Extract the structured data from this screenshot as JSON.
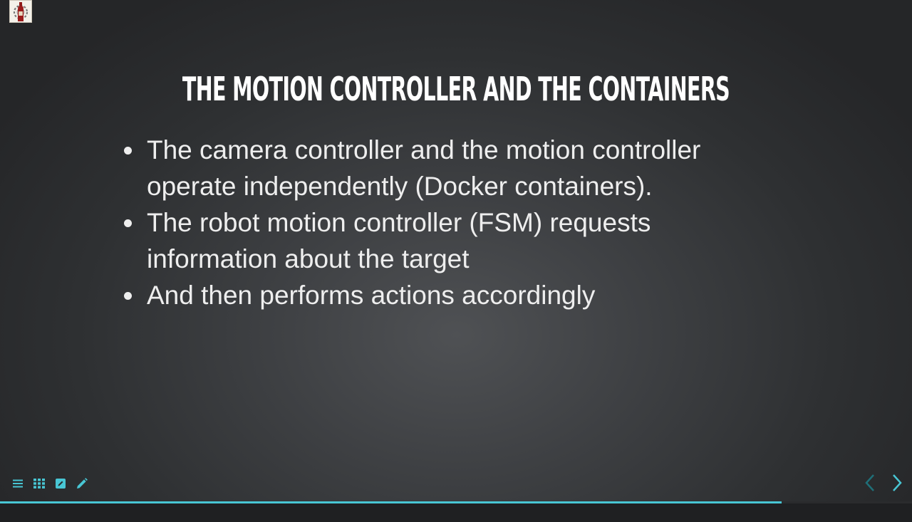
{
  "slide": {
    "title": "THE MOTION CONTROLLER AND THE CONTAINERS",
    "bullets": [
      {
        "line1": "The camera controller and the motion controller",
        "line2": "operate independently (Docker containers)."
      },
      {
        "line1": "The robot motion controller (FSM) requests",
        "line2": "information about the target"
      },
      {
        "line1": "And then performs actions accordingly",
        "line2": ""
      }
    ]
  },
  "toolbar": {
    "icons": [
      "menu-icon",
      "grid-icon",
      "edit-box-icon",
      "pencil-icon"
    ],
    "accent": "#48c6d4"
  },
  "navigation": {
    "prev_icon": "chevron-left-icon",
    "next_icon": "chevron-right-icon",
    "prev_color": "#1f6f78",
    "next_color": "#48c6d4"
  },
  "progress": {
    "fraction": 0.857,
    "color": "#48c6d4"
  },
  "colors": {
    "background_center": "#4f5154",
    "background_edge": "#252628",
    "text": "#eeeeee",
    "logo_red": "#9b1c1c"
  }
}
